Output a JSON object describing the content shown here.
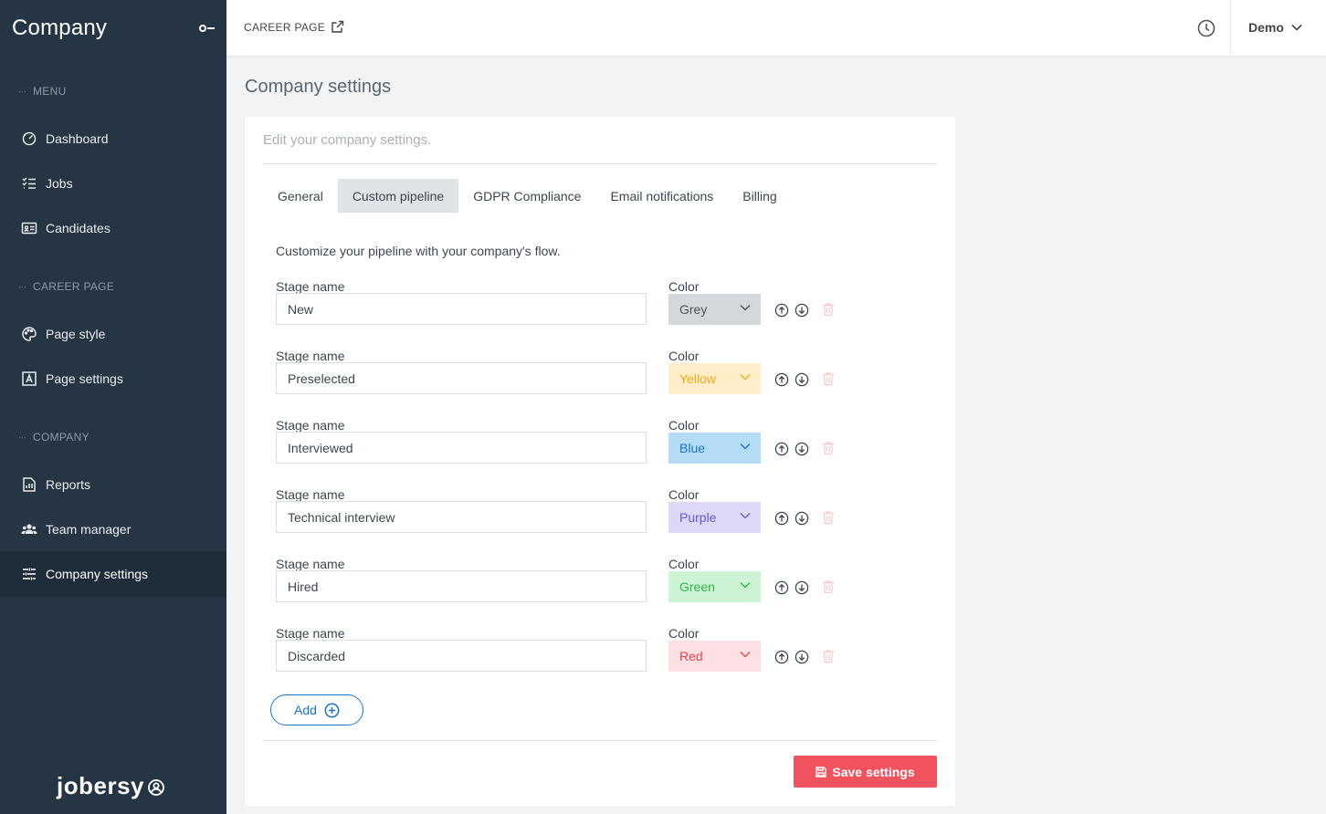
{
  "sidebar": {
    "brand": "Company",
    "sections": {
      "menu": "MENU",
      "career_page": "CAREER PAGE",
      "company": "COMPANY"
    },
    "items": [
      {
        "label": "Dashboard",
        "icon": "dashboard-icon"
      },
      {
        "label": "Jobs",
        "icon": "list-icon"
      },
      {
        "label": "Candidates",
        "icon": "id-card-icon"
      },
      {
        "label": "Page style",
        "icon": "palette-icon"
      },
      {
        "label": "Page settings",
        "icon": "page-settings-icon"
      },
      {
        "label": "Reports",
        "icon": "report-icon"
      },
      {
        "label": "Team manager",
        "icon": "team-icon"
      },
      {
        "label": "Company settings",
        "icon": "sliders-icon",
        "active": true
      }
    ],
    "logo": "jobersy"
  },
  "topbar": {
    "career_link": "CAREER PAGE",
    "user": "Demo"
  },
  "main": {
    "title": "Company settings",
    "subtitle": "Edit your company settings.",
    "tabs": [
      {
        "label": "General"
      },
      {
        "label": "Custom pipeline",
        "active": true
      },
      {
        "label": "GDPR Compliance"
      },
      {
        "label": "Email notifications"
      },
      {
        "label": "Billing"
      }
    ],
    "intro": "Customize your pipeline with your company's flow.",
    "stage_label": "Stage name",
    "color_label": "Color",
    "stages": [
      {
        "name": "New",
        "color": "Grey",
        "bg": "#d4d8dc",
        "fg": "#4a525a"
      },
      {
        "name": "Preselected",
        "color": "Yellow",
        "bg": "#ffeec7",
        "fg": "#f0a81c"
      },
      {
        "name": "Interviewed",
        "color": "Blue",
        "bg": "#b4dcf5",
        "fg": "#1a74c8"
      },
      {
        "name": "Technical interview",
        "color": "Purple",
        "bg": "#ddd8f8",
        "fg": "#6c57d0"
      },
      {
        "name": "Hired",
        "color": "Green",
        "bg": "#cdf3d5",
        "fg": "#2fb54a"
      },
      {
        "name": "Discarded",
        "color": "Red",
        "bg": "#fde0e3",
        "fg": "#e8434f"
      }
    ],
    "add_label": "Add",
    "save_label": "Save settings"
  },
  "colors": {
    "sidebar_bg": "#263544",
    "accent_blue": "#1a74c8",
    "save_red": "#f1535e"
  }
}
